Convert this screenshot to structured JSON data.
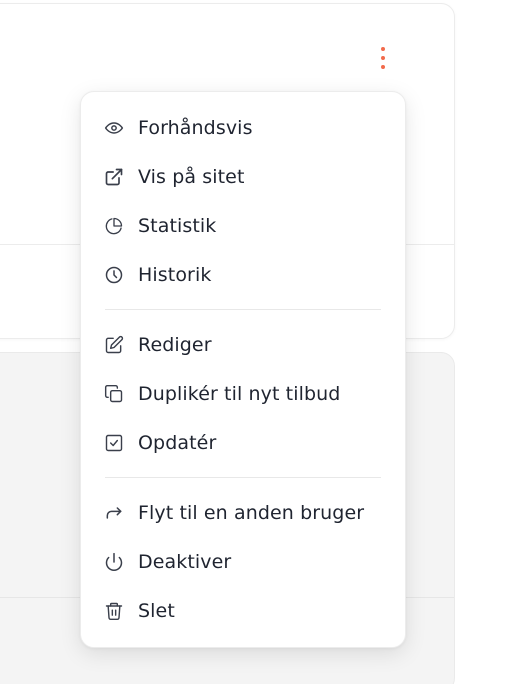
{
  "colors": {
    "accent": "#f26a4b",
    "text": "#1f2430",
    "icon": "#3a3f4b"
  },
  "menu": {
    "groups": [
      {
        "items": [
          {
            "label": "Forhåndsvis",
            "icon": "eye-icon"
          },
          {
            "label": "Vis på sitet",
            "icon": "external-link-icon"
          },
          {
            "label": "Statistik",
            "icon": "pie-chart-icon"
          },
          {
            "label": "Historik",
            "icon": "clock-icon"
          }
        ]
      },
      {
        "items": [
          {
            "label": "Rediger",
            "icon": "edit-icon"
          },
          {
            "label": "Duplikér til nyt tilbud",
            "icon": "copy-icon"
          },
          {
            "label": "Opdatér",
            "icon": "check-square-icon"
          }
        ]
      },
      {
        "items": [
          {
            "label": "Flyt til en anden bruger",
            "icon": "forward-arrow-icon"
          },
          {
            "label": "Deaktiver",
            "icon": "power-icon"
          },
          {
            "label": "Slet",
            "icon": "trash-icon"
          }
        ]
      }
    ]
  }
}
